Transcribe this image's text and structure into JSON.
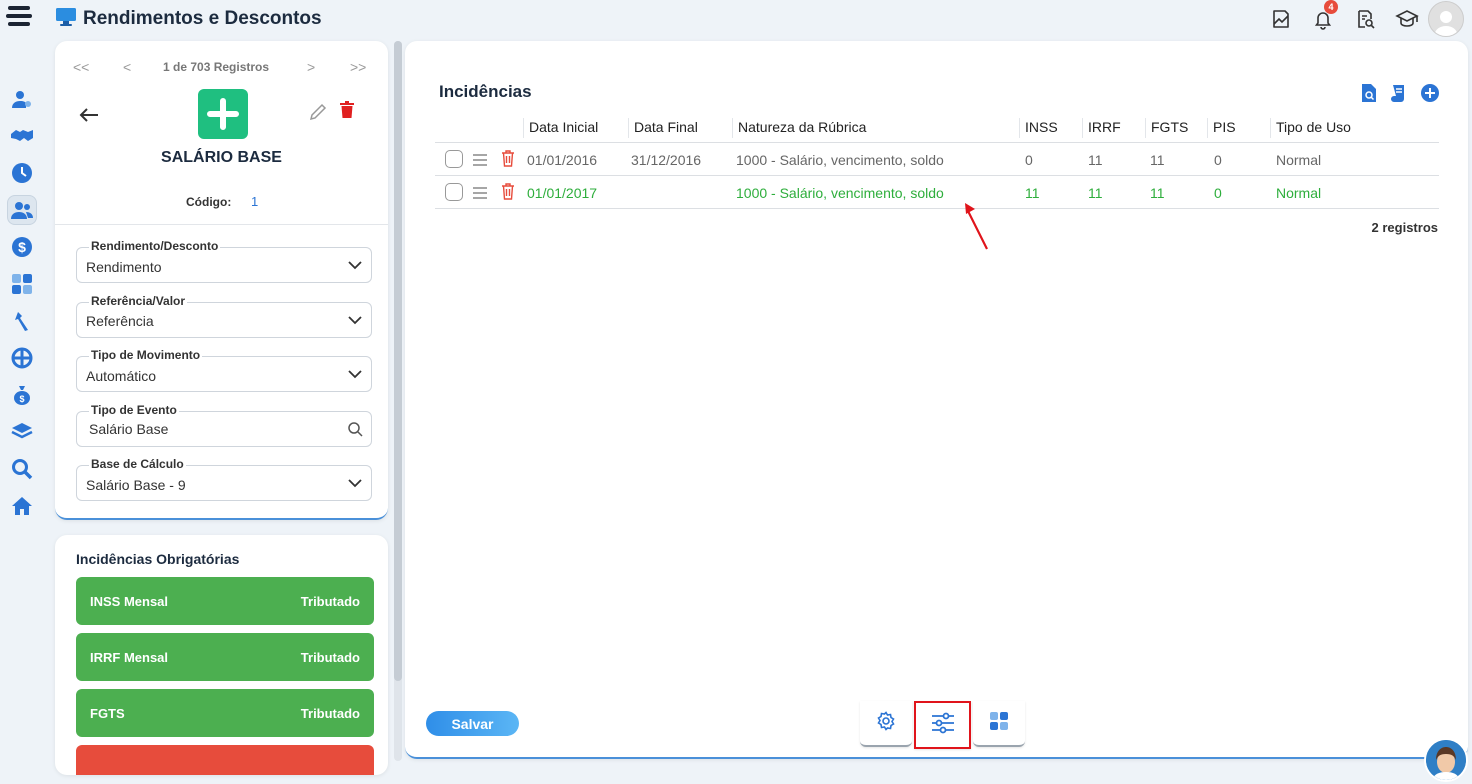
{
  "app": {
    "title": "Rendimentos e Descontos",
    "notification_count": "4"
  },
  "record": {
    "pager_first": "<<",
    "pager_prev": "<",
    "pager_label": "1 de 703 Registros",
    "pager_next": ">",
    "pager_last": ">>",
    "title": "SALÁRIO BASE",
    "codigo_label": "Código:",
    "codigo_value": "1",
    "fields": [
      {
        "label": "Rendimento/Desconto",
        "value": "Rendimento",
        "icon": "chevron-down-icon"
      },
      {
        "label": "Referência/Valor",
        "value": "Referência",
        "icon": "chevron-down-icon"
      },
      {
        "label": "Tipo de Movimento",
        "value": "Automático",
        "icon": "chevron-down-icon"
      },
      {
        "label": "Tipo de Evento",
        "value": "Salário Base",
        "icon": "search-icon"
      },
      {
        "label": "Base de Cálculo",
        "value": "Salário Base - 9",
        "icon": "chevron-down-icon"
      }
    ]
  },
  "obrigatorias": {
    "title": "Incidências Obrigatórias",
    "items": [
      {
        "name": "INSS Mensal",
        "status": "Tributado",
        "color": "#4caf50"
      },
      {
        "name": "IRRF Mensal",
        "status": "Tributado",
        "color": "#4caf50"
      },
      {
        "name": "FGTS",
        "status": "Tributado",
        "color": "#4caf50"
      }
    ]
  },
  "incidencias": {
    "title": "Incidências",
    "columns": [
      "Data Inicial",
      "Data Final",
      "Natureza da Rúbrica",
      "INSS",
      "IRRF",
      "FGTS",
      "PIS",
      "Tipo de Uso"
    ],
    "rows": [
      {
        "data_inicial": "01/01/2016",
        "data_final": "31/12/2016",
        "natureza": "1000 - Salário, vencimento, soldo",
        "inss": "0",
        "irrf": "11",
        "fgts": "11",
        "pis": "0",
        "tipo_uso": "Normal",
        "highlight": false
      },
      {
        "data_inicial": "01/01/2017",
        "data_final": "",
        "natureza": "1000 - Salário, vencimento, soldo",
        "inss": "11",
        "irrf": "11",
        "fgts": "11",
        "pis": "0",
        "tipo_uso": "Normal",
        "highlight": true
      }
    ],
    "count_label": "2 registros",
    "save_label": "Salvar"
  },
  "colors": {
    "accent": "#2b74d4",
    "green": "#1fbf80",
    "success": "#4caf50",
    "danger": "#e74c3c",
    "highlight_text": "#2eae3c"
  }
}
